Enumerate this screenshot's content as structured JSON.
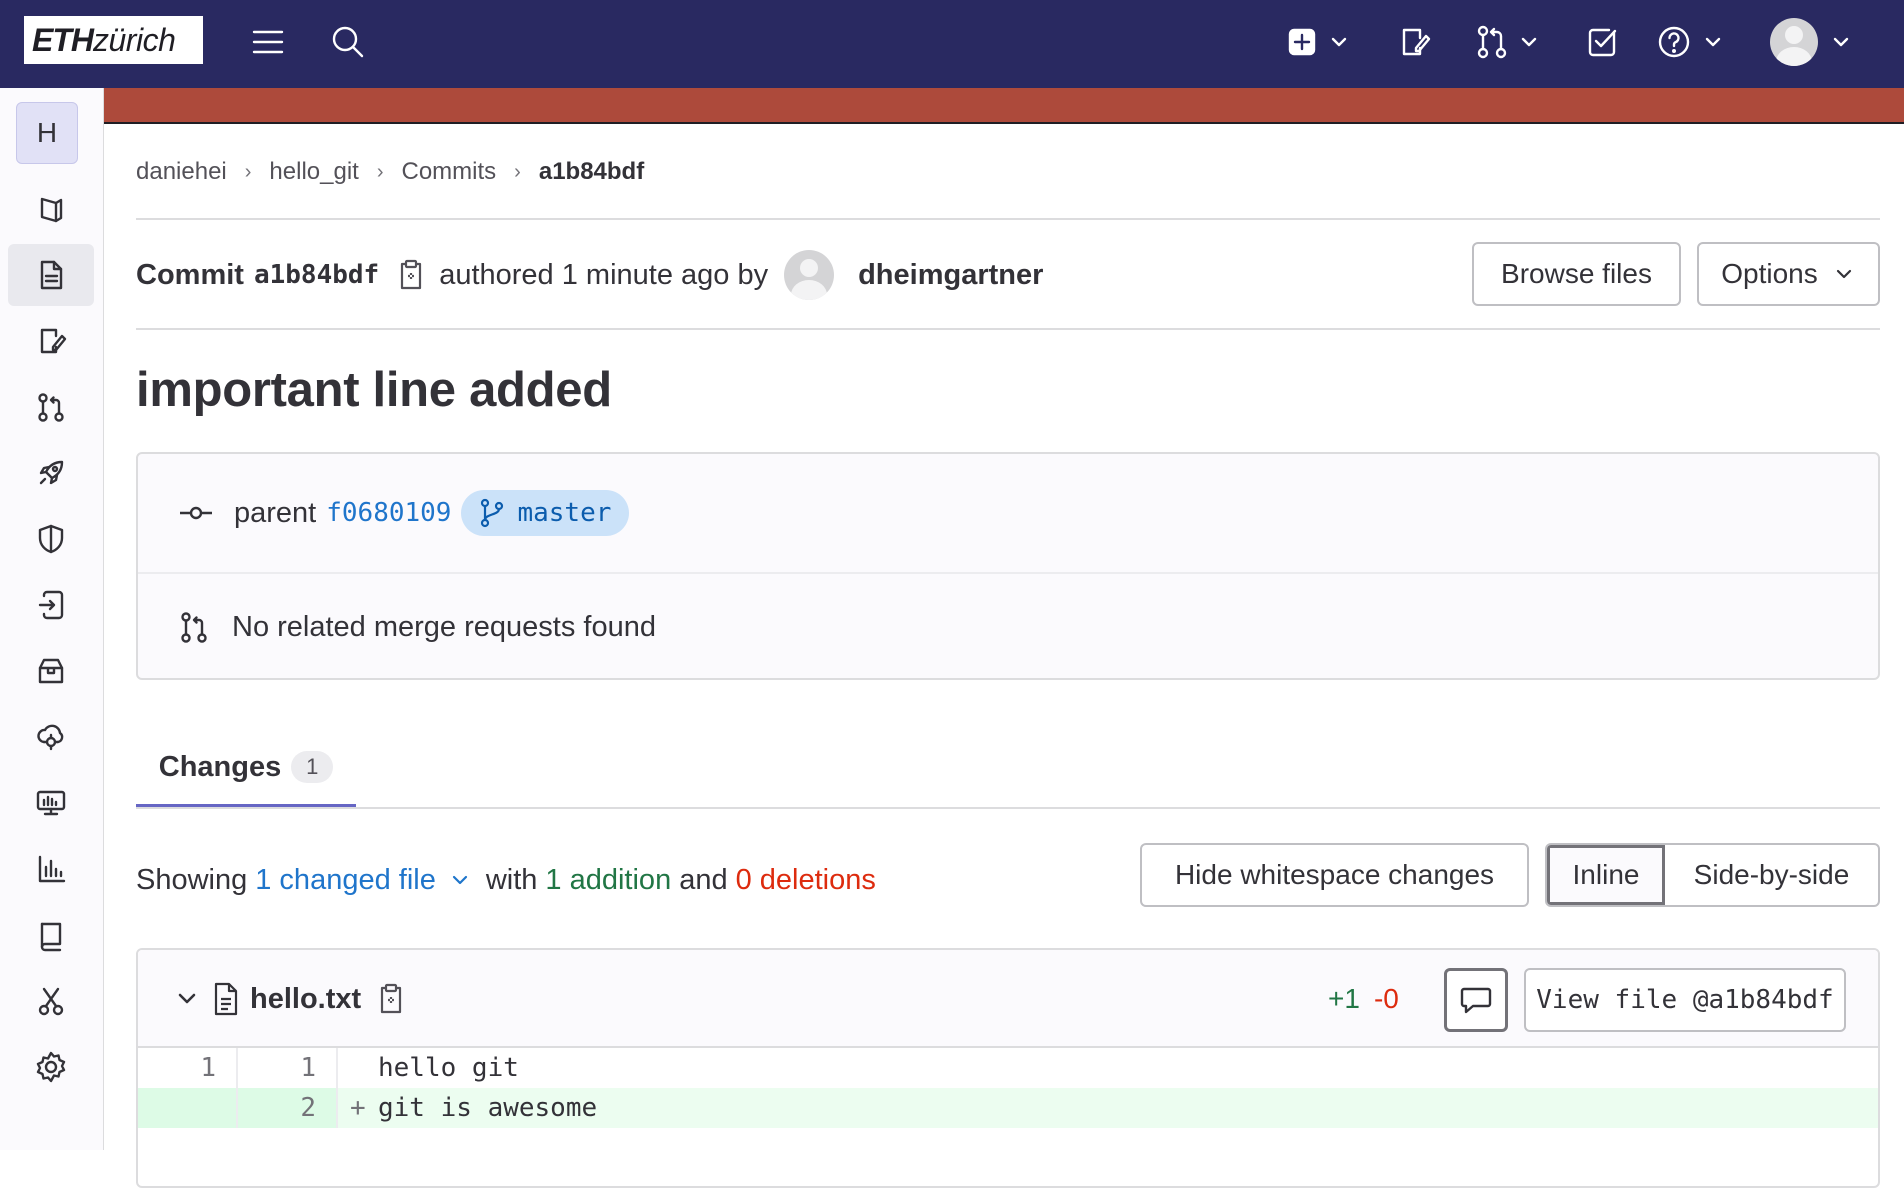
{
  "header": {
    "logo_main": "ETH",
    "logo_sub": "zürich"
  },
  "sidebar": {
    "project_initial": "H",
    "items": [
      {
        "icon": "project-overview-icon"
      },
      {
        "icon": "repository-icon",
        "active": true
      },
      {
        "icon": "issues-icon"
      },
      {
        "icon": "merge-requests-icon"
      },
      {
        "icon": "ci-cd-rocket-icon"
      },
      {
        "icon": "security-shield-icon"
      },
      {
        "icon": "deployments-icon"
      },
      {
        "icon": "packages-icon"
      },
      {
        "icon": "infrastructure-icon"
      },
      {
        "icon": "monitor-icon"
      },
      {
        "icon": "analytics-icon"
      },
      {
        "icon": "wiki-icon"
      },
      {
        "icon": "snippets-icon"
      },
      {
        "icon": "settings-icon"
      }
    ]
  },
  "breadcrumb": {
    "items": [
      "daniehei",
      "hello_git",
      "Commits"
    ],
    "current": "a1b84bdf"
  },
  "commit": {
    "label": "Commit",
    "sha": "a1b84bdf",
    "authored_text": "authored 1 minute ago by",
    "author": "dheimgartner",
    "browse_files": "Browse files",
    "options": "Options",
    "title": "important line added",
    "parent_label": "parent",
    "parent_sha": "f0680109",
    "branch": "master",
    "merge_requests_text": "No related merge requests found"
  },
  "tabs": {
    "changes_label": "Changes",
    "changes_count": "1"
  },
  "summary": {
    "showing": "Showing",
    "changed_files": "1 changed file",
    "with": "with",
    "additions": "1 addition",
    "and": "and",
    "deletions": "0 deletions",
    "hide_whitespace": "Hide whitespace changes",
    "inline": "Inline",
    "side_by_side": "Side-by-side"
  },
  "file": {
    "name": "hello.txt",
    "added": "+1",
    "removed": "-0",
    "view_file": "View file @a1b84bdf",
    "lines": [
      {
        "old": "1",
        "new": "1",
        "marker": " ",
        "text": "hello git",
        "type": "context"
      },
      {
        "old": "",
        "new": "2",
        "marker": "+",
        "text": "git is awesome",
        "type": "added"
      }
    ]
  },
  "colors": {
    "topbar": "#292961",
    "banner": "#ad4a3b",
    "tab_underline": "#6666c4",
    "link": "#1f75cb",
    "addition": "#217645",
    "deletion": "#dd2b0e"
  }
}
